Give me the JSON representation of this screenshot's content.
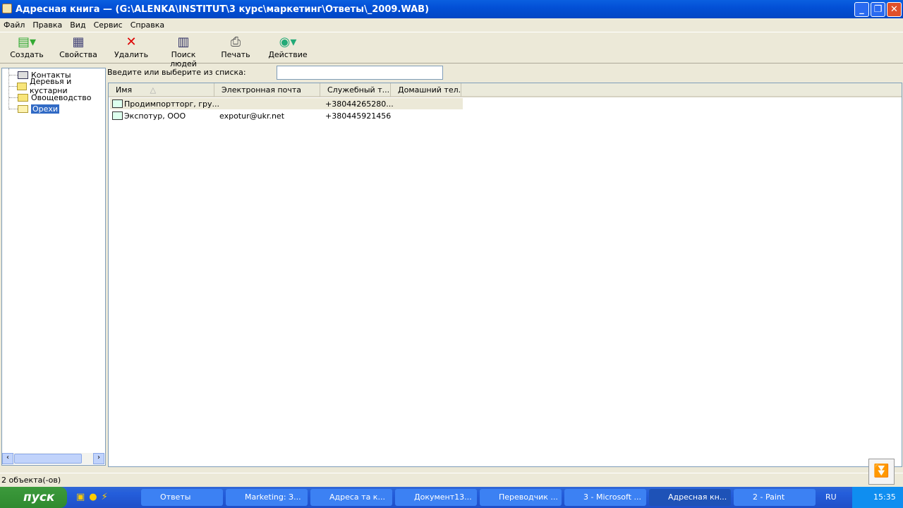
{
  "window": {
    "title": "Адресная книга — (G:\\ALENKA\\INSTITUT\\3 курс\\маркетинг\\Ответы\\_2009.WAB)"
  },
  "menu": [
    "Файл",
    "Правка",
    "Вид",
    "Сервис",
    "Справка"
  ],
  "toolbar": [
    {
      "label": "Создать",
      "icon": "new-contact-icon"
    },
    {
      "label": "Свойства",
      "icon": "properties-icon"
    },
    {
      "label": "Удалить",
      "icon": "delete-icon"
    },
    {
      "label": "Поиск людей",
      "icon": "find-people-icon"
    },
    {
      "label": "Печать",
      "icon": "print-icon"
    },
    {
      "label": "Действие",
      "icon": "action-icon"
    }
  ],
  "tree": [
    "Контакты",
    "Деревья и кустарни",
    "Овощеводство",
    "Орехи"
  ],
  "search": {
    "label": "Введите или выберите из списка:",
    "value": ""
  },
  "columns": [
    "Имя",
    "Электронная почта",
    "Служебный т...",
    "Домашний тел..."
  ],
  "rows": [
    {
      "name": "Продимпортторг, гру...",
      "email": "",
      "work": "+38044265280...",
      "home": ""
    },
    {
      "name": "Экспотур, ООО",
      "email": "expotur@ukr.net",
      "work": "+380445921456",
      "home": ""
    }
  ],
  "status": "2 объекта(-ов)",
  "taskbar": {
    "start": "пуск",
    "items": [
      "Ответы",
      "Marketing: З...",
      "Адреса та к...",
      "Документ13...",
      "Переводчик ...",
      "3 - Microsoft ...",
      "Адресная кн...",
      "2 - Paint"
    ],
    "lang": "RU",
    "clock": "15:35"
  }
}
